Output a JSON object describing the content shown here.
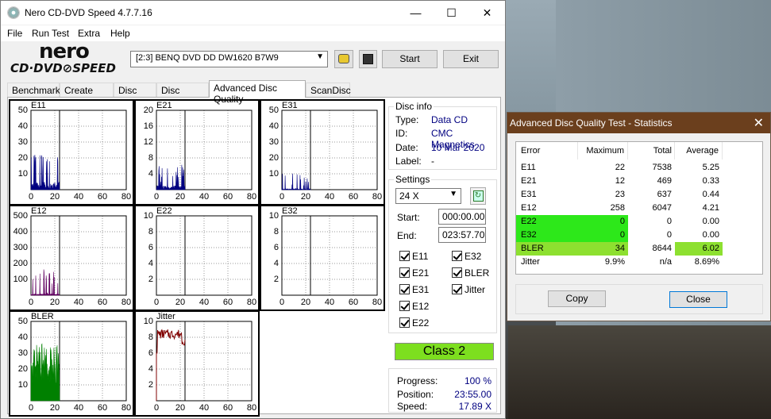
{
  "app": {
    "title": "Nero CD-DVD Speed 4.7.7.16",
    "logo_top": "nero",
    "logo_bottom": "CD·DVD⊘SPEED"
  },
  "window": {
    "minimize": "—",
    "maximize": "☐",
    "close": "✕"
  },
  "menu": [
    "File",
    "Run Test",
    "Extra",
    "Help"
  ],
  "toolbar": {
    "drive": "[2:3]   BENQ DVD DD DW1620 B7W9",
    "start": "Start",
    "exit": "Exit"
  },
  "tabs": [
    "Benchmark",
    "Create Disc",
    "Disc Info",
    "Disc Quality",
    "Advanced Disc Quality",
    "ScanDisc"
  ],
  "charts": [
    {
      "name": "E11",
      "yticks": [
        "50",
        "40",
        "30",
        "20",
        "10"
      ],
      "xticks": [
        "0",
        "20",
        "40",
        "60",
        "80"
      ]
    },
    {
      "name": "E21",
      "yticks": [
        "20",
        "16",
        "12",
        "8",
        "4"
      ],
      "xticks": [
        "0",
        "20",
        "40",
        "60",
        "80"
      ]
    },
    {
      "name": "E31",
      "yticks": [
        "50",
        "40",
        "30",
        "20",
        "10"
      ],
      "xticks": [
        "0",
        "20",
        "40",
        "60",
        "80"
      ]
    },
    {
      "name": "E12",
      "yticks": [
        "500",
        "400",
        "300",
        "200",
        "100"
      ],
      "xticks": [
        "0",
        "20",
        "40",
        "60",
        "80"
      ]
    },
    {
      "name": "E22",
      "yticks": [
        "10",
        "8",
        "6",
        "4",
        "2"
      ],
      "xticks": [
        "0",
        "20",
        "40",
        "60",
        "80"
      ]
    },
    {
      "name": "E32",
      "yticks": [
        "10",
        "8",
        "6",
        "4",
        "2"
      ],
      "xticks": [
        "0",
        "20",
        "40",
        "60",
        "80"
      ]
    },
    {
      "name": "BLER",
      "yticks": [
        "50",
        "40",
        "30",
        "20",
        "10"
      ],
      "xticks": [
        "0",
        "20",
        "40",
        "60",
        "80"
      ]
    },
    {
      "name": "Jitter",
      "yticks": [
        "10",
        "8",
        "6",
        "4",
        "2"
      ],
      "xticks": [
        "0",
        "20",
        "40",
        "60",
        "80"
      ]
    }
  ],
  "disc_info": {
    "caption": "Disc info",
    "type_label": "Type:",
    "type": "Data CD",
    "id_label": "ID:",
    "id": "CMC Magnetics",
    "date_label": "Date:",
    "date": "10 Mar 2020",
    "label_label": "Label:",
    "label": "-"
  },
  "settings": {
    "caption": "Settings",
    "speed": "24 X",
    "start_label": "Start:",
    "start": "000:00.00",
    "end_label": "End:",
    "end": "023:57.70",
    "checks": [
      "E11",
      "E32",
      "E21",
      "BLER",
      "E31",
      "Jitter",
      "E12",
      "E22"
    ]
  },
  "class": "Class 2",
  "progress": {
    "progress_label": "Progress:",
    "progress": "100 %",
    "position_label": "Position:",
    "position": "23:55.00",
    "speed_label": "Speed:",
    "speed": "17.89 X"
  },
  "stats": {
    "title": "Advanced Disc Quality Test - Statistics",
    "close": "✕",
    "headers": [
      "Error",
      "Maximum",
      "Total",
      "Average"
    ],
    "rows": [
      {
        "error": "E11",
        "max": "22",
        "total": "7538",
        "avg": "5.25"
      },
      {
        "error": "E21",
        "max": "12",
        "total": "469",
        "avg": "0.33"
      },
      {
        "error": "E31",
        "max": "23",
        "total": "637",
        "avg": "0.44"
      },
      {
        "error": "E12",
        "max": "258",
        "total": "6047",
        "avg": "4.21"
      },
      {
        "error": "E22",
        "max": "0",
        "total": "0",
        "avg": "0.00"
      },
      {
        "error": "E32",
        "max": "0",
        "total": "0",
        "avg": "0.00"
      },
      {
        "error": "BLER",
        "max": "34",
        "total": "8644",
        "avg": "6.02"
      },
      {
        "error": "Jitter",
        "max": "9.9%",
        "total": "n/a",
        "avg": "8.69%"
      }
    ],
    "copy": "Copy",
    "close_btn": "Close"
  },
  "colors": {
    "e11": "#000080",
    "e12": "#600060",
    "bler": "#008000",
    "jitter": "#800000",
    "class_bg": "#7ddf1f",
    "highlight": "#2de81a"
  }
}
